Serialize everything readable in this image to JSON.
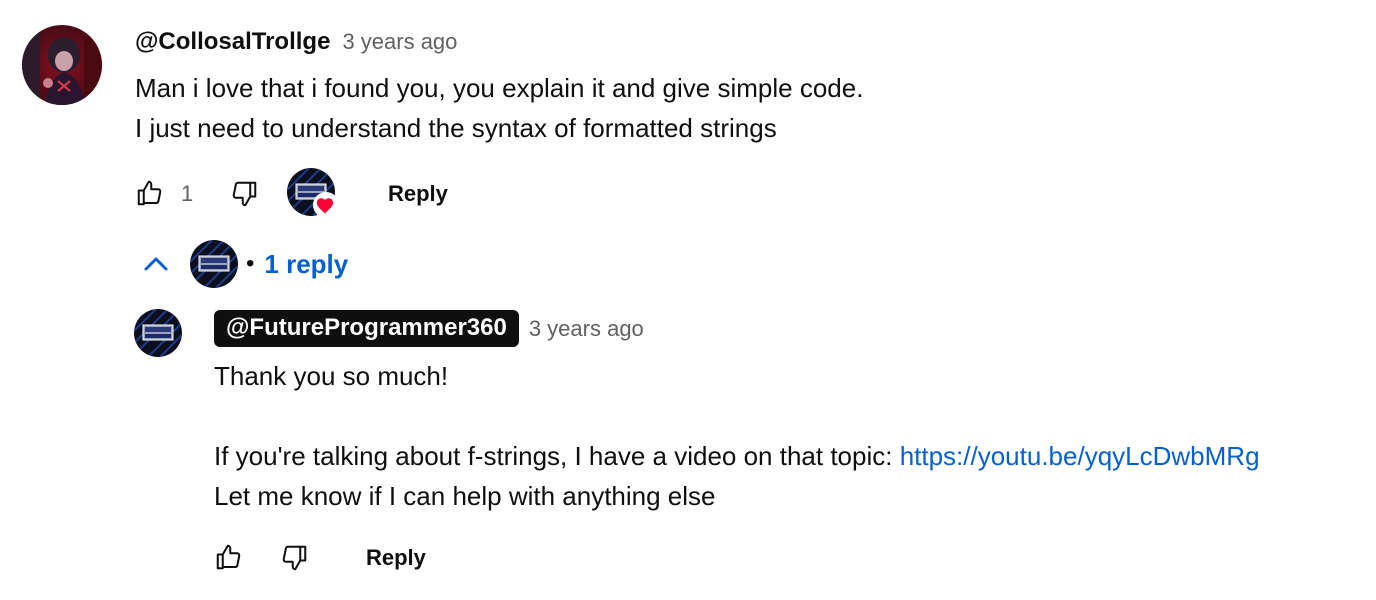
{
  "comment": {
    "author": "@CollosalTrollge",
    "time": "3 years ago",
    "text_lines": [
      "Man i love that i found you, you explain it and give simple code.",
      "I just need to understand the syntax of formatted strings"
    ],
    "like_count": "1",
    "reply_label": "Reply",
    "like_icon": "thumbs-up-icon",
    "dislike_icon": "thumbs-down-icon",
    "creator_heart_icon": "creator-heart-icon"
  },
  "replies_toggle": {
    "label": "1 reply",
    "separator": "•",
    "icon": "chevron-up-icon"
  },
  "reply": {
    "author": "@FutureProgrammer360",
    "time": "3 years ago",
    "line1": "Thank you so much!",
    "line2_prefix": "If you're talking about f-strings, I have a video on that topic: ",
    "link": "https://youtu.be/yqyLcDwbMRg",
    "line3": "Let me know if I can help with anything else",
    "reply_label": "Reply"
  },
  "colors": {
    "link": "#065fd4",
    "meta": "#606060",
    "heart": "#ff0033"
  }
}
